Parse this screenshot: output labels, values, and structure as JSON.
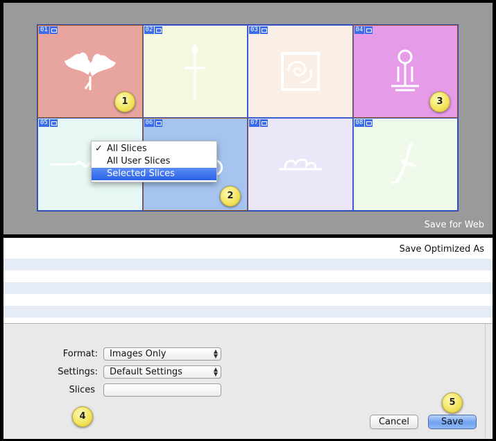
{
  "preview": {
    "caption": "Save for Web",
    "slices": [
      {
        "num": "01",
        "color": "#e8a49f",
        "icon": "leaves-icon",
        "selected": true
      },
      {
        "num": "02",
        "color": "#f7f8e2",
        "icon": "cross-flourish-icon",
        "selected": false
      },
      {
        "num": "03",
        "color": "#faefe6",
        "icon": "ornate-square-icon",
        "selected": false
      },
      {
        "num": "04",
        "color": "#e69be9",
        "icon": "fleur-de-lis-icon",
        "selected": true
      },
      {
        "num": "05",
        "color": "#e7f8f4",
        "icon": "scroll-divider-icon",
        "selected": false
      },
      {
        "num": "06",
        "color": "#a6c4ef",
        "icon": "cloud-swirl-icon",
        "selected": true
      },
      {
        "num": "07",
        "color": "#ebe7f9",
        "icon": "small-swirl-icon",
        "selected": false
      },
      {
        "num": "08",
        "color": "#effaea",
        "icon": "sword-flourish-icon",
        "selected": false
      }
    ],
    "callouts": [
      "1",
      "2",
      "3",
      "4",
      "5"
    ]
  },
  "dialog": {
    "title": "Save Optimized As",
    "format_label": "Format:",
    "format_value": "Images Only",
    "settings_label": "Settings:",
    "settings_value": "Default Settings",
    "slices_label": "Slices",
    "slices_menu": [
      {
        "label": "All Slices",
        "checked": true,
        "highlighted": false
      },
      {
        "label": "All User Slices",
        "checked": false,
        "highlighted": false
      },
      {
        "label": "Selected Slices",
        "checked": false,
        "highlighted": true
      }
    ],
    "check_mark": "✓",
    "cancel_label": "Cancel",
    "save_label": "Save",
    "accent_color": "#2a63e8"
  }
}
